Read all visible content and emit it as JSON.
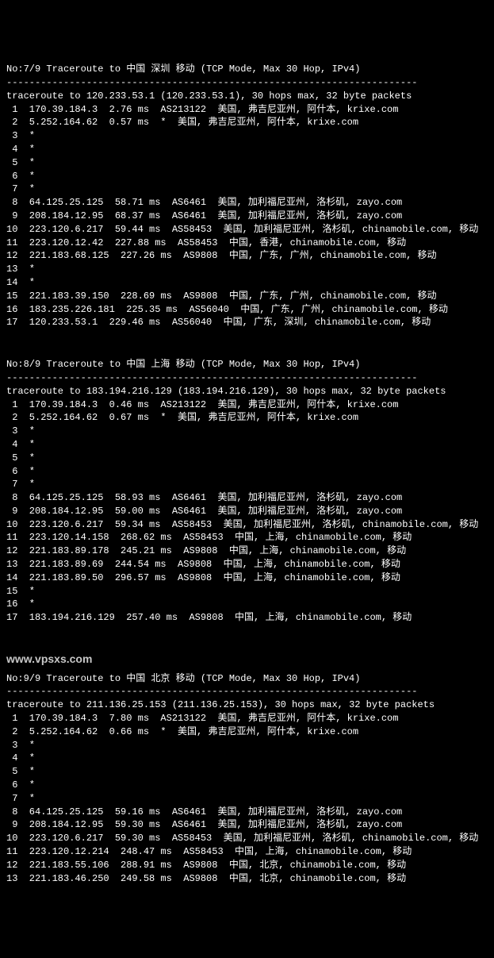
{
  "watermark": "www.vpsxs.com",
  "sections": [
    {
      "header": "No:7/9 Traceroute to 中国 深圳 移动 (TCP Mode, Max 30 Hop, IPv4)",
      "divider": "------------------------------------------------------------------------",
      "summary": "traceroute to 120.233.53.1 (120.233.53.1), 30 hops max, 32 byte packets",
      "hops": [
        " 1  170.39.184.3  2.76 ms  AS213122  美国, 弗吉尼亚州, 阿什本, krixe.com",
        " 2  5.252.164.62  0.57 ms  *  美国, 弗吉尼亚州, 阿什本, krixe.com",
        " 3  *",
        " 4  *",
        " 5  *",
        " 6  *",
        " 7  *",
        " 8  64.125.25.125  58.71 ms  AS6461  美国, 加利福尼亚州, 洛杉矶, zayo.com",
        " 9  208.184.12.95  68.37 ms  AS6461  美国, 加利福尼亚州, 洛杉矶, zayo.com",
        "10  223.120.6.217  59.44 ms  AS58453  美国, 加利福尼亚州, 洛杉矶, chinamobile.com, 移动",
        "11  223.120.12.42  227.88 ms  AS58453  中国, 香港, chinamobile.com, 移动",
        "12  221.183.68.125  227.26 ms  AS9808  中国, 广东, 广州, chinamobile.com, 移动",
        "13  *",
        "14  *",
        "15  221.183.39.150  228.69 ms  AS9808  中国, 广东, 广州, chinamobile.com, 移动",
        "16  183.235.226.181  225.35 ms  AS56040  中国, 广东, 广州, chinamobile.com, 移动",
        "17  120.233.53.1  229.46 ms  AS56040  中国, 广东, 深圳, chinamobile.com, 移动"
      ]
    },
    {
      "header": "No:8/9 Traceroute to 中国 上海 移动 (TCP Mode, Max 30 Hop, IPv4)",
      "divider": "------------------------------------------------------------------------",
      "summary": "traceroute to 183.194.216.129 (183.194.216.129), 30 hops max, 32 byte packets",
      "hops": [
        " 1  170.39.184.3  0.46 ms  AS213122  美国, 弗吉尼亚州, 阿什本, krixe.com",
        " 2  5.252.164.62  0.67 ms  *  美国, 弗吉尼亚州, 阿什本, krixe.com",
        " 3  *",
        " 4  *",
        " 5  *",
        " 6  *",
        " 7  *",
        " 8  64.125.25.125  58.93 ms  AS6461  美国, 加利福尼亚州, 洛杉矶, zayo.com",
        " 9  208.184.12.95  59.00 ms  AS6461  美国, 加利福尼亚州, 洛杉矶, zayo.com",
        "10  223.120.6.217  59.34 ms  AS58453  美国, 加利福尼亚州, 洛杉矶, chinamobile.com, 移动",
        "11  223.120.14.158  268.62 ms  AS58453  中国, 上海, chinamobile.com, 移动",
        "12  221.183.89.178  245.21 ms  AS9808  中国, 上海, chinamobile.com, 移动",
        "13  221.183.89.69  244.54 ms  AS9808  中国, 上海, chinamobile.com, 移动",
        "14  221.183.89.50  296.57 ms  AS9808  中国, 上海, chinamobile.com, 移动",
        "15  *",
        "16  *",
        "17  183.194.216.129  257.40 ms  AS9808  中国, 上海, chinamobile.com, 移动"
      ]
    },
    {
      "header": "No:9/9 Traceroute to 中国 北京 移动 (TCP Mode, Max 30 Hop, IPv4)",
      "divider": "------------------------------------------------------------------------",
      "summary": "traceroute to 211.136.25.153 (211.136.25.153), 30 hops max, 32 byte packets",
      "hops": [
        " 1  170.39.184.3  7.80 ms  AS213122  美国, 弗吉尼亚州, 阿什本, krixe.com",
        " 2  5.252.164.62  0.66 ms  *  美国, 弗吉尼亚州, 阿什本, krixe.com",
        " 3  *",
        " 4  *",
        " 5  *",
        " 6  *",
        " 7  *",
        " 8  64.125.25.125  59.16 ms  AS6461  美国, 加利福尼亚州, 洛杉矶, zayo.com",
        " 9  208.184.12.95  59.30 ms  AS6461  美国, 加利福尼亚州, 洛杉矶, zayo.com",
        "10  223.120.6.217  59.30 ms  AS58453  美国, 加利福尼亚州, 洛杉矶, chinamobile.com, 移动",
        "11  223.120.12.214  248.47 ms  AS58453  中国, 上海, chinamobile.com, 移动",
        "12  221.183.55.106  288.91 ms  AS9808  中国, 北京, chinamobile.com, 移动",
        "13  221.183.46.250  249.58 ms  AS9808  中国, 北京, chinamobile.com, 移动"
      ]
    }
  ]
}
